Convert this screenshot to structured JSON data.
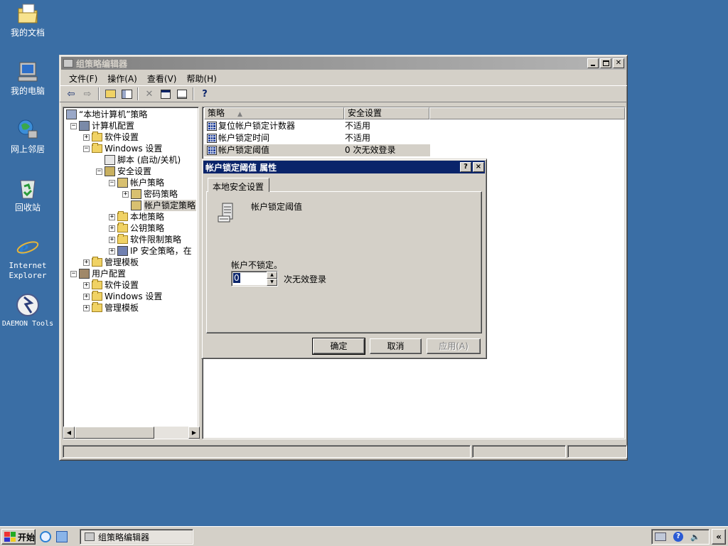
{
  "desktop": {
    "icons": [
      {
        "label": "我的文档",
        "icon": "my-documents-icon"
      },
      {
        "label": "我的电脑",
        "icon": "my-computer-icon"
      },
      {
        "label": "网上邻居",
        "icon": "network-places-icon"
      },
      {
        "label": "回收站",
        "icon": "recycle-bin-icon"
      },
      {
        "label": "Internet Explorer",
        "icon": "ie-icon"
      },
      {
        "label": "DAEMON Tools",
        "icon": "daemon-tools-icon"
      }
    ]
  },
  "window": {
    "title": "组策略编辑器",
    "menu": [
      "文件(F)",
      "操作(A)",
      "查看(V)",
      "帮助(H)"
    ],
    "toolbar": [
      "back-arrow-icon",
      "forward-arrow-icon",
      "up-folder-icon",
      "show-tree-icon",
      "delete-icon",
      "properties-icon",
      "export-list-icon",
      "help-icon"
    ],
    "tree": [
      {
        "label": "“本地计算机”策略",
        "level": 0,
        "expander": ""
      },
      {
        "label": "计算机配置",
        "level": 1,
        "expander": "−"
      },
      {
        "label": "软件设置",
        "level": 2,
        "expander": "+"
      },
      {
        "label": "Windows 设置",
        "level": 2,
        "expander": "−"
      },
      {
        "label": "脚本 (启动/关机)",
        "level": 3,
        "expander": ""
      },
      {
        "label": "安全设置",
        "level": 3,
        "expander": "−"
      },
      {
        "label": "帐户策略",
        "level": 4,
        "expander": "−"
      },
      {
        "label": "密码策略",
        "level": 5,
        "expander": "+"
      },
      {
        "label": "帐户锁定策略",
        "level": 5,
        "expander": ""
      },
      {
        "label": "本地策略",
        "level": 4,
        "expander": "+"
      },
      {
        "label": "公钥策略",
        "level": 4,
        "expander": "+"
      },
      {
        "label": "软件限制策略",
        "level": 4,
        "expander": "+"
      },
      {
        "label": "IP 安全策略，在",
        "level": 4,
        "expander": "+"
      },
      {
        "label": "管理模板",
        "level": 2,
        "expander": "+"
      },
      {
        "label": "用户配置",
        "level": 1,
        "expander": "−"
      },
      {
        "label": "软件设置",
        "level": 2,
        "expander": "+"
      },
      {
        "label": "Windows 设置",
        "level": 2,
        "expander": "+"
      },
      {
        "label": "管理模板",
        "level": 2,
        "expander": "+"
      }
    ],
    "columns": [
      "策略",
      "安全设置"
    ],
    "rows": [
      {
        "policy": "复位帐户锁定计数器",
        "setting": "不适用"
      },
      {
        "policy": "帐户锁定时间",
        "setting": "不适用"
      },
      {
        "policy": "帐户锁定阈值",
        "setting": "0 次无效登录"
      }
    ]
  },
  "dialog": {
    "title": "帐户锁定阈值 属性",
    "help_btn": "?",
    "close_btn": "×",
    "tab": "本地安全设置",
    "heading": "帐户锁定阈值",
    "status": "帐户不锁定。",
    "value": "0",
    "unit": "次无效登录",
    "ok": "确定",
    "cancel": "取消",
    "apply": "应用(A)"
  },
  "taskbar": {
    "start": "开始",
    "task": "组策略编辑器",
    "tray_chevron": "«"
  }
}
